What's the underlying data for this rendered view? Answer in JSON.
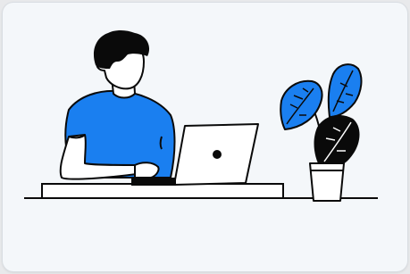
{
  "colors": {
    "background": "#e8e9eb",
    "card": "#f4f7fa",
    "accent": "#1a7ff0",
    "ink": "#0a0a0a",
    "white": "#ffffff"
  },
  "illustration": {
    "subject": "person-working-on-laptop",
    "icons": [
      "person-figure",
      "laptop-icon",
      "monstera-plant-icon",
      "desk"
    ]
  }
}
